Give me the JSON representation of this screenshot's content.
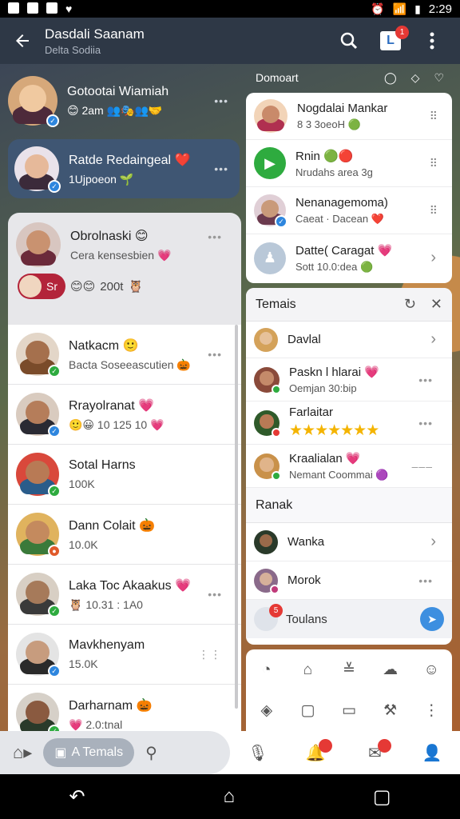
{
  "status_bar": {
    "time": "2:29"
  },
  "app_bar": {
    "title": "Dasdali Saanam",
    "subtitle": "Delta Sodiia",
    "badge_count": "1"
  },
  "conversations": {
    "top": {
      "name": "Gotootai Wiamiah",
      "sub": "2am"
    },
    "selected": {
      "name": "Ratde Redaingeal",
      "sub": "1Ujpoeon"
    }
  },
  "group": {
    "name": "Obrolnaski",
    "sub": "Cera kensesbien",
    "pill_label": "Sr",
    "count": "200t"
  },
  "list": [
    {
      "name": "Natkacm",
      "sub": "Bacta Soseeascutien",
      "accent": "#7a4b2a"
    },
    {
      "name": "Rrayolranat",
      "sub": "10 125 10",
      "accent": "#3b2b22"
    },
    {
      "name": "Sotal Harns",
      "sub": "100K",
      "accent": "#c03a2b"
    },
    {
      "name": "Dann Colait",
      "sub": "10.0K",
      "accent": "#d8a24e"
    },
    {
      "name": "Laka Toc Akaakus",
      "sub": "10.31 : 1A0",
      "accent": "#4a3326"
    },
    {
      "name": "Mavkhenyam",
      "sub": "15.0K",
      "accent": "#cfcfcf"
    },
    {
      "name": "Darharnam",
      "sub": "2.0:tnal",
      "accent": "#2f2a28"
    }
  ],
  "right_header": {
    "title": "Domoart"
  },
  "contacts": [
    {
      "name": "Nogdalai Mankar",
      "sub": "8 3 3oeoH",
      "accent": "#c13a55"
    },
    {
      "name": "Rnin",
      "sub": "Nrudahs area 3g",
      "accent": "#2eab3f"
    },
    {
      "name": "Nenanagemoma)",
      "sub": "Caeat · Dacean",
      "accent": "#6b3a4e"
    },
    {
      "name": "Datte( Caragat",
      "sub": "Sott 10.0:dea",
      "accent": "#b9c8d8"
    }
  ],
  "teams": {
    "title": "Temais",
    "rows": [
      {
        "name": "Davlal",
        "sub": "",
        "accent": "#d4a25a"
      },
      {
        "name": "Paskn l hlarai",
        "sub": "Oemjan 30:bip",
        "accent": "#5a2e26"
      },
      {
        "name": "Farlaitar",
        "sub": "",
        "stars": "★★★★★★★",
        "accent": "#2f5a2a"
      },
      {
        "name": "Kraalialan",
        "sub": "Nemant Coommai",
        "accent": "#c9914a"
      }
    ],
    "section_label": "Ranak",
    "rank_rows": [
      {
        "name": "Wanka",
        "accent": "#2a3a2a"
      },
      {
        "name": "Morok",
        "accent": "#8a6a8a"
      }
    ],
    "compose_placeholder": "Toulans",
    "compose_badge": "5"
  },
  "bottom_nav": {
    "active_label": "A Temals"
  }
}
